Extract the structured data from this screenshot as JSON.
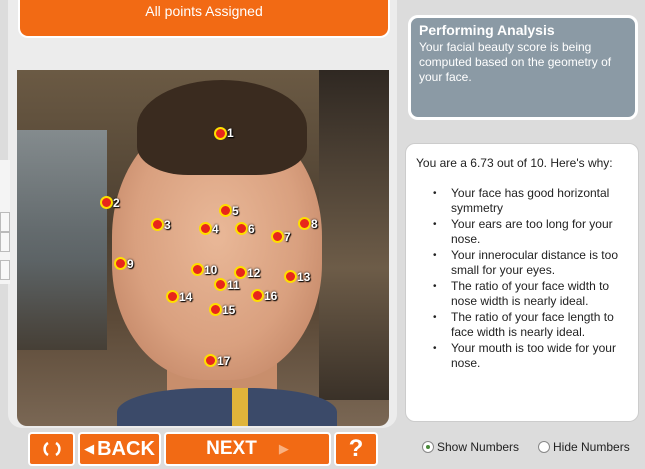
{
  "banner": {
    "text": "All points Assigned"
  },
  "photo": {
    "points": [
      {
        "id": "1",
        "label": "1"
      },
      {
        "id": "2",
        "label": "2"
      },
      {
        "id": "3",
        "label": "3"
      },
      {
        "id": "4",
        "label": "4"
      },
      {
        "id": "5",
        "label": "5"
      },
      {
        "id": "6",
        "label": "6"
      },
      {
        "id": "7",
        "label": "7"
      },
      {
        "id": "8",
        "label": "8"
      },
      {
        "id": "9",
        "label": "9"
      },
      {
        "id": "10",
        "label": "10"
      },
      {
        "id": "11",
        "label": "11"
      },
      {
        "id": "12",
        "label": "12"
      },
      {
        "id": "13",
        "label": "13"
      },
      {
        "id": "14",
        "label": "14"
      },
      {
        "id": "15",
        "label": "15"
      },
      {
        "id": "16",
        "label": "16"
      },
      {
        "id": "17",
        "label": "17"
      }
    ]
  },
  "controls": {
    "reset_icon": "refresh-icon",
    "back_label": "BACK",
    "next_label": "NEXT",
    "help_label": "?"
  },
  "analysis": {
    "title": "Performing Analysis",
    "text": "Your facial beauty score is being computed based on the geometry of your face."
  },
  "score": {
    "summary": "You are a 6.73 out of 10.  Here's why:",
    "reasons": [
      "Your face has good horizontal symmetry",
      "Your ears are too long for your nose.",
      "Your innerocular distance is too small for your eyes.",
      "The ratio of your face width to nose width is nearly ideal.",
      "The ratio of your face length to face width is nearly ideal.",
      "Your mouth is too wide for your nose."
    ]
  },
  "options": {
    "show_numbers": "Show Numbers",
    "hide_numbers": "Hide Numbers",
    "selected": "show_numbers"
  },
  "colors": {
    "accent": "#f26a14",
    "panel": "#8b9aa5",
    "point": "#e8261b",
    "point_ring": "#ffde00"
  }
}
